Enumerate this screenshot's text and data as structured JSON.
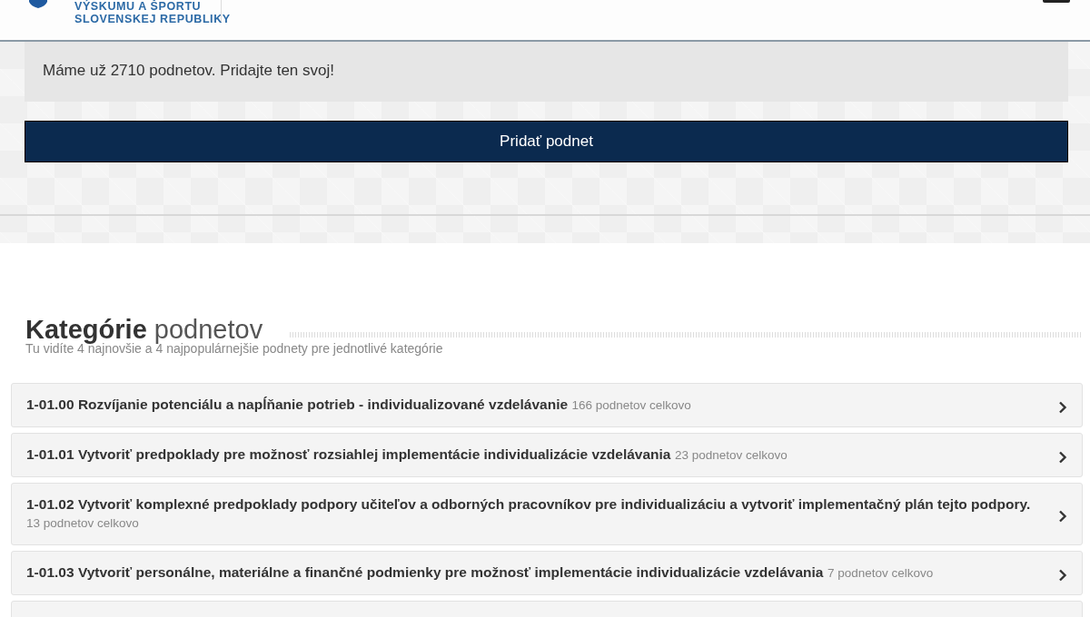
{
  "header": {
    "logo_lines": [
      "VÝSKUMU A ŠPORTU",
      "SLOVENSKEJ REPUBLIKY"
    ]
  },
  "hero": {
    "message": "Máme už 2710 podnetov. Pridajte ten svoj!",
    "button": "Pridať podnet"
  },
  "categories": {
    "heading": "**Kategórie** podnetov",
    "subtitle": "Tu vidíte 4 najnovšie a 4 najpopulárnejšie podnety pre jednotlivé kategórie",
    "items": [
      {
        "title": "1-01.00 Rozvíjanie potenciálu a napĺňanie potrieb - individualizované vzdelávanie",
        "count": "166 podnetov celkovo"
      },
      {
        "title": "1-01.01 Vytvoriť predpoklady pre možnosť rozsiahlej implementácie individualizácie vzdelávania",
        "count": "23 podnetov celkovo"
      },
      {
        "title": "1-01.02 Vytvoriť komplexné predpoklady podpory učiteľov a odborných pracovníkov pre individualizáciu a vytvoriť implementačný plán tejto podpory.",
        "count": "13 podnetov celkovo"
      },
      {
        "title": "1-01.03 Vytvoriť personálne, materiálne a finančné podmienky pre možnosť implementácie individualizácie vzdelávania",
        "count": "7 podnetov celkovo"
      }
    ]
  }
}
